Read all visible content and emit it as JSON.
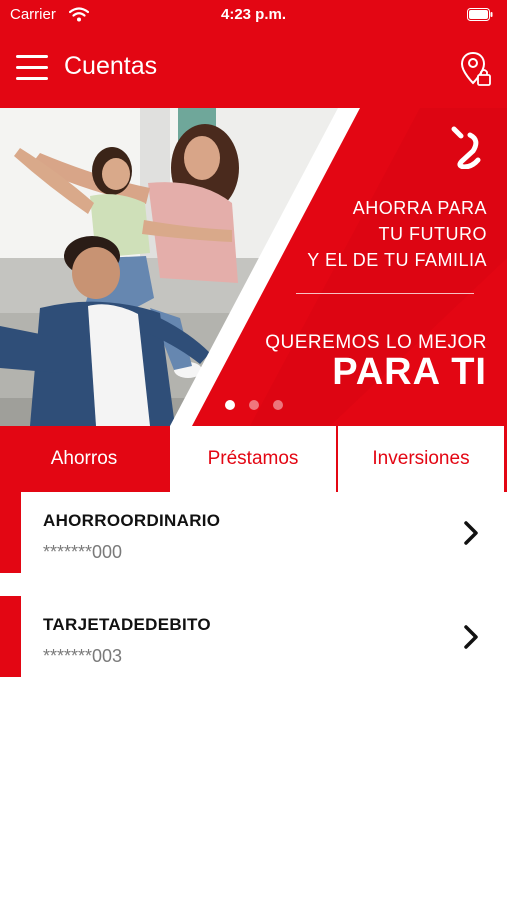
{
  "status_bar": {
    "carrier": "Carrier",
    "time": "4:23 p.m."
  },
  "header": {
    "title": "Cuentas",
    "menu_icon": "hamburger-menu-icon",
    "action_icon": "location-lock-icon"
  },
  "banner": {
    "line1": "AHORRA PARA",
    "line2": "TU FUTURO",
    "line3": "Y EL DE TU FAMILIA",
    "subtitle": "QUEREMOS LO MEJOR",
    "headline": "PARA TI",
    "carousel_total": 3,
    "carousel_active": 1
  },
  "tabs": [
    {
      "label": "Ahorros",
      "active": true
    },
    {
      "label": "Préstamos",
      "active": false
    },
    {
      "label": "Inversiones",
      "active": false
    }
  ],
  "accounts": [
    {
      "name": "AHORROORDINARIO",
      "number": "*******000"
    },
    {
      "name": "TARJETADEDEBITO",
      "number": "*******003"
    }
  ],
  "colors": {
    "brand_red": "#e30613",
    "text_dark": "#111111",
    "text_muted": "#7a7a7a"
  }
}
